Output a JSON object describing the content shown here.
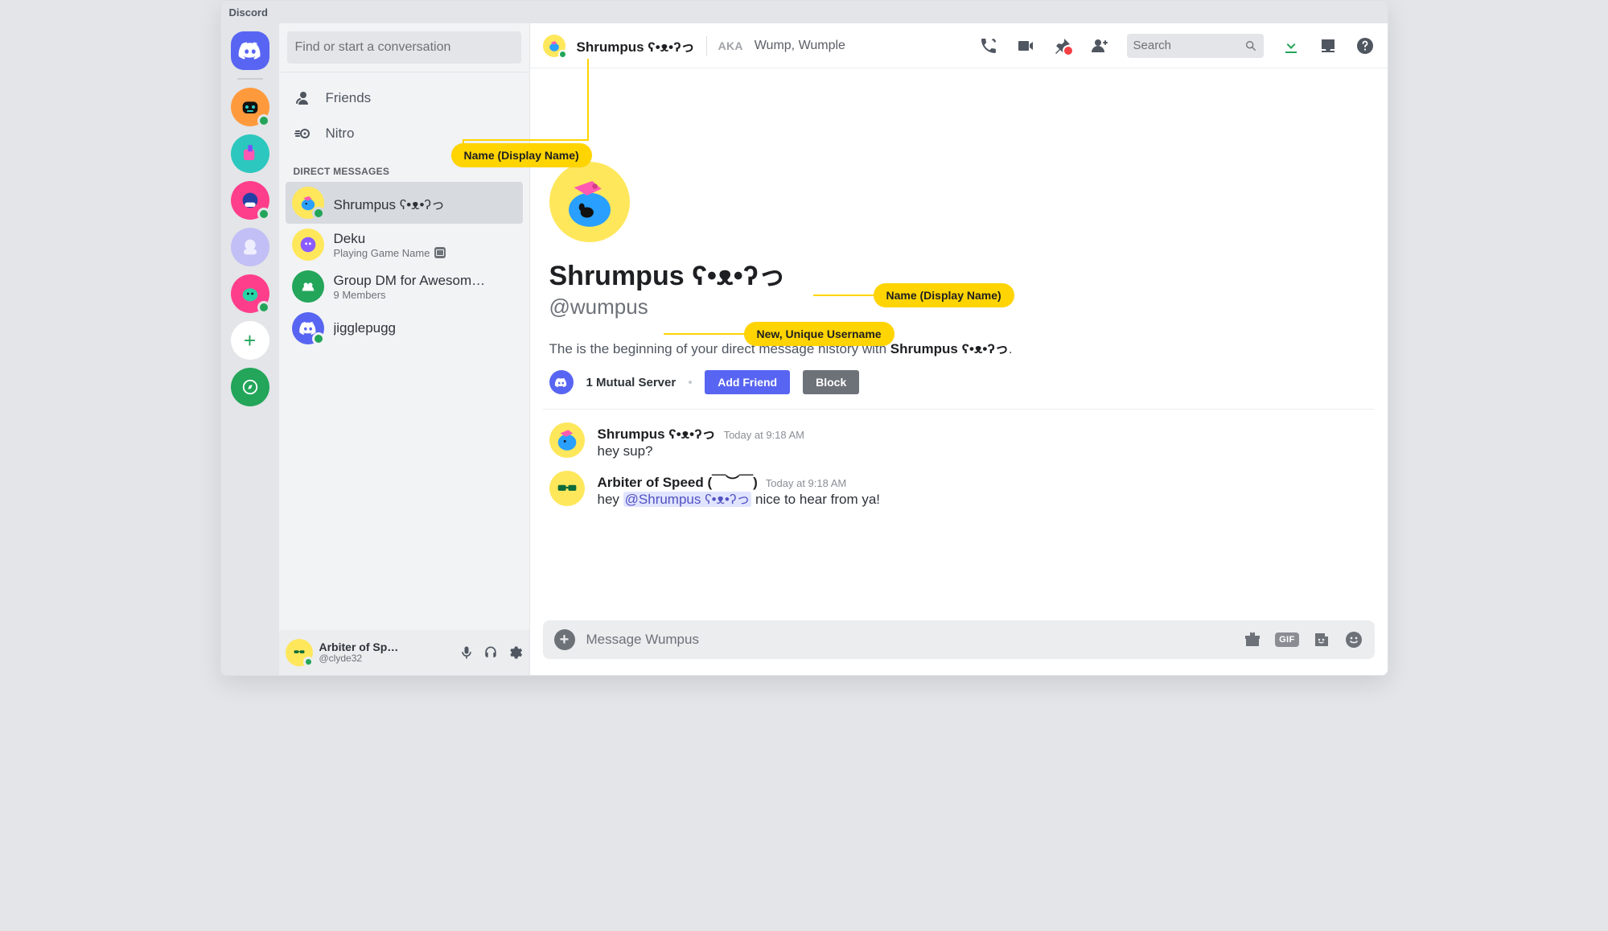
{
  "app_title": "Discord",
  "search_sidebar_placeholder": "Find or start a conversation",
  "nav": {
    "friends": "Friends",
    "nitro": "Nitro"
  },
  "dm_section_title": "DIRECT MESSAGES",
  "dms": {
    "shrumpus": {
      "name": "Shrumpus ʕ•ᴥ•ʔっ"
    },
    "deku": {
      "name": "Deku",
      "sub": "Playing Game Name"
    },
    "group": {
      "name": "Group DM for Awesom…",
      "sub": "9 Members"
    },
    "jiggle": {
      "name": "jigglepugg"
    }
  },
  "me": {
    "name": "Arbiter of Sp…",
    "handle": "@clyde32"
  },
  "header": {
    "title": "Shrumpus ʕ•ᴥ•ʔっ",
    "aka_label": "AKA",
    "aka_names": "Wump, Wumple",
    "search_placeholder": "Search"
  },
  "profile": {
    "display_name": "Shrumpus ʕ•ᴥ•ʔっ",
    "handle": "@wumpus",
    "history_prefix": "The is the beginning of your direct message history with ",
    "history_name": "Shrumpus ʕ•ᴥ•ʔっ",
    "history_suffix": ".",
    "mutual": "1 Mutual Server",
    "add_friend": "Add Friend",
    "block": "Block"
  },
  "messages": {
    "m1": {
      "author": "Shrumpus ʕ•ᴥ•ʔっ",
      "time": "Today at 9:18 AM",
      "text": "hey sup?"
    },
    "m2": {
      "author": "Arbiter of Speed (￣︶￣)",
      "time": "Today at 9:18 AM",
      "text_pre": "hey ",
      "mention": "@Shrumpus ʕ•ᴥ•ʔっ",
      "text_post": " nice to hear from ya!"
    }
  },
  "composer": {
    "placeholder": "Message Wumpus",
    "gif_label": "GIF"
  },
  "annotations": {
    "display_name_header": "Name (Display Name)",
    "display_name_profile": "Name (Display Name)",
    "unique_username": "New, Unique  Username"
  }
}
